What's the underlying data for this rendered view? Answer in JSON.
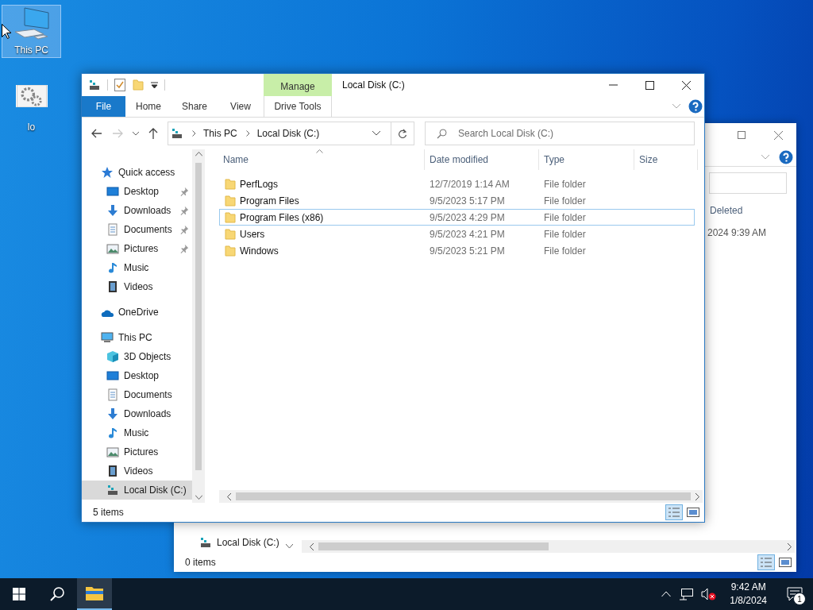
{
  "desktop_icons": [
    {
      "label": "This PC",
      "kind": "pc",
      "selected": true
    },
    {
      "label": "lo",
      "kind": "settings",
      "selected": false
    }
  ],
  "back_window": {
    "header_text": "Deleted",
    "row_text": "2024 9:39 AM",
    "nav_items": [
      {
        "label": "Local Disk (C:)",
        "kind": "drive"
      }
    ],
    "status": "0 items",
    "views": [
      {
        "kind": "details",
        "selected": true
      },
      {
        "kind": "tiles",
        "selected": false
      }
    ]
  },
  "window": {
    "title": "Local Disk (C:)",
    "context_group": "Manage",
    "tabs": [
      {
        "label": "File",
        "kind": "file",
        "selected": false
      },
      {
        "label": "Home",
        "kind": "tab",
        "selected": false
      },
      {
        "label": "Share",
        "kind": "tab",
        "selected": false
      },
      {
        "label": "View",
        "kind": "tab",
        "selected": false
      },
      {
        "label": "Drive Tools",
        "kind": "context",
        "selected": false
      }
    ],
    "breadcrumbs": [
      "This PC",
      "Local Disk (C:)"
    ],
    "search": {
      "placeholder": "Search Local Disk (C:)"
    },
    "nav": [
      {
        "label": "Quick access",
        "kind": "quick",
        "selected": false,
        "children": [
          {
            "label": "Desktop",
            "kind": "desktop",
            "pinned": true,
            "selected": false
          },
          {
            "label": "Downloads",
            "kind": "downloads",
            "pinned": true,
            "selected": false
          },
          {
            "label": "Documents",
            "kind": "documents",
            "pinned": true,
            "selected": false
          },
          {
            "label": "Pictures",
            "kind": "pictures",
            "pinned": true,
            "selected": false
          },
          {
            "label": "Music",
            "kind": "music",
            "pinned": false,
            "selected": false
          },
          {
            "label": "Videos",
            "kind": "videos",
            "pinned": false,
            "selected": false
          }
        ]
      },
      {
        "label": "OneDrive",
        "kind": "onedrive",
        "selected": false
      },
      {
        "label": "This PC",
        "kind": "pc",
        "selected": false,
        "children": [
          {
            "label": "3D Objects",
            "kind": "objects3d",
            "pinned": false,
            "selected": false
          },
          {
            "label": "Desktop",
            "kind": "desktop",
            "pinned": false,
            "selected": false
          },
          {
            "label": "Documents",
            "kind": "documents",
            "pinned": false,
            "selected": false
          },
          {
            "label": "Downloads",
            "kind": "downloads",
            "pinned": false,
            "selected": false
          },
          {
            "label": "Music",
            "kind": "music",
            "pinned": false,
            "selected": false
          },
          {
            "label": "Pictures",
            "kind": "pictures",
            "pinned": false,
            "selected": false
          },
          {
            "label": "Videos",
            "kind": "videos",
            "pinned": false,
            "selected": false
          },
          {
            "label": "Local Disk (C:)",
            "kind": "drive",
            "pinned": false,
            "selected": true
          }
        ]
      }
    ],
    "columns": [
      {
        "label": "Name",
        "sorted": true
      },
      {
        "label": "Date modified",
        "sorted": false
      },
      {
        "label": "Type",
        "sorted": false
      },
      {
        "label": "Size",
        "sorted": false
      }
    ],
    "rows": [
      {
        "name": "PerfLogs",
        "date": "12/7/2019 1:14 AM",
        "type": "File folder",
        "focused": false
      },
      {
        "name": "Program Files",
        "date": "9/5/2023 5:17 PM",
        "type": "File folder",
        "focused": false
      },
      {
        "name": "Program Files (x86)",
        "date": "9/5/2023 4:29 PM",
        "type": "File folder",
        "focused": true
      },
      {
        "name": "Users",
        "date": "9/5/2023 4:21 PM",
        "type": "File folder",
        "focused": false
      },
      {
        "name": "Windows",
        "date": "9/5/2023 5:21 PM",
        "type": "File folder",
        "focused": false
      }
    ],
    "status_bar": {
      "count": "5 items"
    },
    "views": [
      {
        "kind": "details",
        "selected": true
      },
      {
        "kind": "tiles",
        "selected": false
      }
    ]
  },
  "taskbar": {
    "apps": [
      {
        "kind": "explorer",
        "active": true
      }
    ],
    "time": "9:42 AM",
    "date": "1/8/2024",
    "notification_count": "1",
    "volume_muted": true
  }
}
